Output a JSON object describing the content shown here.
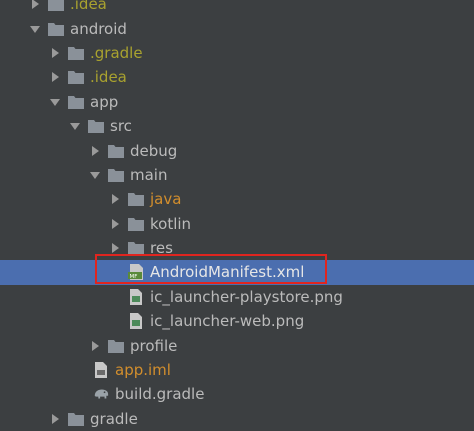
{
  "project_tree": {
    "rows": [
      {
        "label": ".idea",
        "color": "#a9a22f",
        "icon": "folder-icon",
        "expanded": false
      },
      {
        "label": "android",
        "color": "#bbbbbb",
        "icon": "folder-icon",
        "expanded": true
      },
      {
        "label": ".gradle",
        "color": "#a9a22f",
        "icon": "folder-icon",
        "expanded": false
      },
      {
        "label": ".idea",
        "color": "#a9a22f",
        "icon": "folder-icon",
        "expanded": false
      },
      {
        "label": "app",
        "color": "#bbbbbb",
        "icon": "folder-icon",
        "expanded": true
      },
      {
        "label": "src",
        "color": "#bbbbbb",
        "icon": "folder-icon",
        "expanded": true
      },
      {
        "label": "debug",
        "color": "#bbbbbb",
        "icon": "folder-icon",
        "expanded": false
      },
      {
        "label": "main",
        "color": "#bbbbbb",
        "icon": "folder-icon",
        "expanded": true
      },
      {
        "label": "java",
        "color": "#d28e2d",
        "icon": "folder-icon",
        "expanded": false
      },
      {
        "label": "kotlin",
        "color": "#bbbbbb",
        "icon": "folder-icon",
        "expanded": false
      },
      {
        "label": "res",
        "color": "#bbbbbb",
        "icon": "folder-icon",
        "expanded": false
      },
      {
        "label": "AndroidManifest.xml",
        "color": "#ffffff",
        "icon": "manifest-file-icon",
        "selected": true
      },
      {
        "label": "ic_launcher-playstore.png",
        "color": "#bbbbbb",
        "icon": "image-file-icon"
      },
      {
        "label": "ic_launcher-web.png",
        "color": "#bbbbbb",
        "icon": "image-file-icon"
      },
      {
        "label": "profile",
        "color": "#bbbbbb",
        "icon": "folder-icon",
        "expanded": false
      },
      {
        "label": "app.iml",
        "color": "#d28e2d",
        "icon": "module-file-icon"
      },
      {
        "label": "build.gradle",
        "color": "#bbbbbb",
        "icon": "gradle-file-icon"
      },
      {
        "label": "gradle",
        "color": "#bbbbbb",
        "icon": "folder-icon",
        "expanded": false
      }
    ]
  },
  "colors": {
    "background": "#3c3f41",
    "selection": "#4b6eaf",
    "highlight_border": "#e0251f",
    "folder": "#8a9199"
  }
}
